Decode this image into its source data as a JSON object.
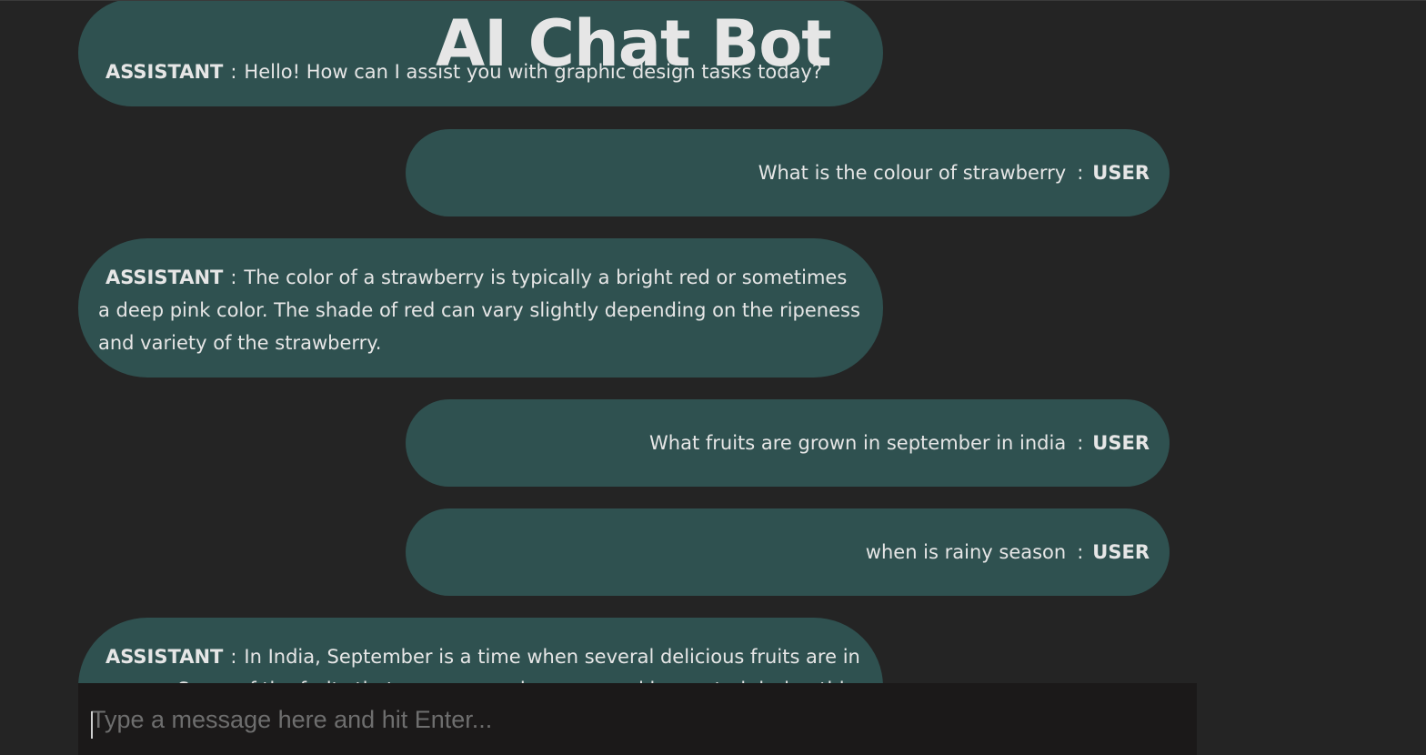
{
  "app": {
    "title": "AI Chat Bot"
  },
  "messages": [
    {
      "role": "assistant",
      "role_label": "ASSISTANT",
      "separator": ":",
      "text": "Hello! How can I assist you with graphic design tasks today?"
    },
    {
      "role": "user",
      "role_label": "USER",
      "separator": ":",
      "text": "What is the colour of strawberry"
    },
    {
      "role": "assistant",
      "role_label": "ASSISTANT",
      "separator": ":",
      "text": "The color of a strawberry is typically a bright red or sometimes a deep pink color. The shade of red can vary slightly depending on the ripeness and variety of the strawberry."
    },
    {
      "role": "user",
      "role_label": "USER",
      "separator": ":",
      "text": "What fruits are grown in september in india"
    },
    {
      "role": "user",
      "role_label": "USER",
      "separator": ":",
      "text": "when is rainy season"
    },
    {
      "role": "assistant",
      "role_label": "ASSISTANT",
      "separator": ":",
      "text": "In India, September is a time when several delicious fruits are in season. Some of the fruits that are commonly grown and harvested during this"
    }
  ],
  "composer": {
    "placeholder": "Type a message here and hit Enter...",
    "value": ""
  },
  "colors": {
    "background": "#242424",
    "bubble": "#2f5150",
    "text": "#e6e6e6",
    "input_background": "#1b1919",
    "placeholder": "#6e6e6e"
  }
}
